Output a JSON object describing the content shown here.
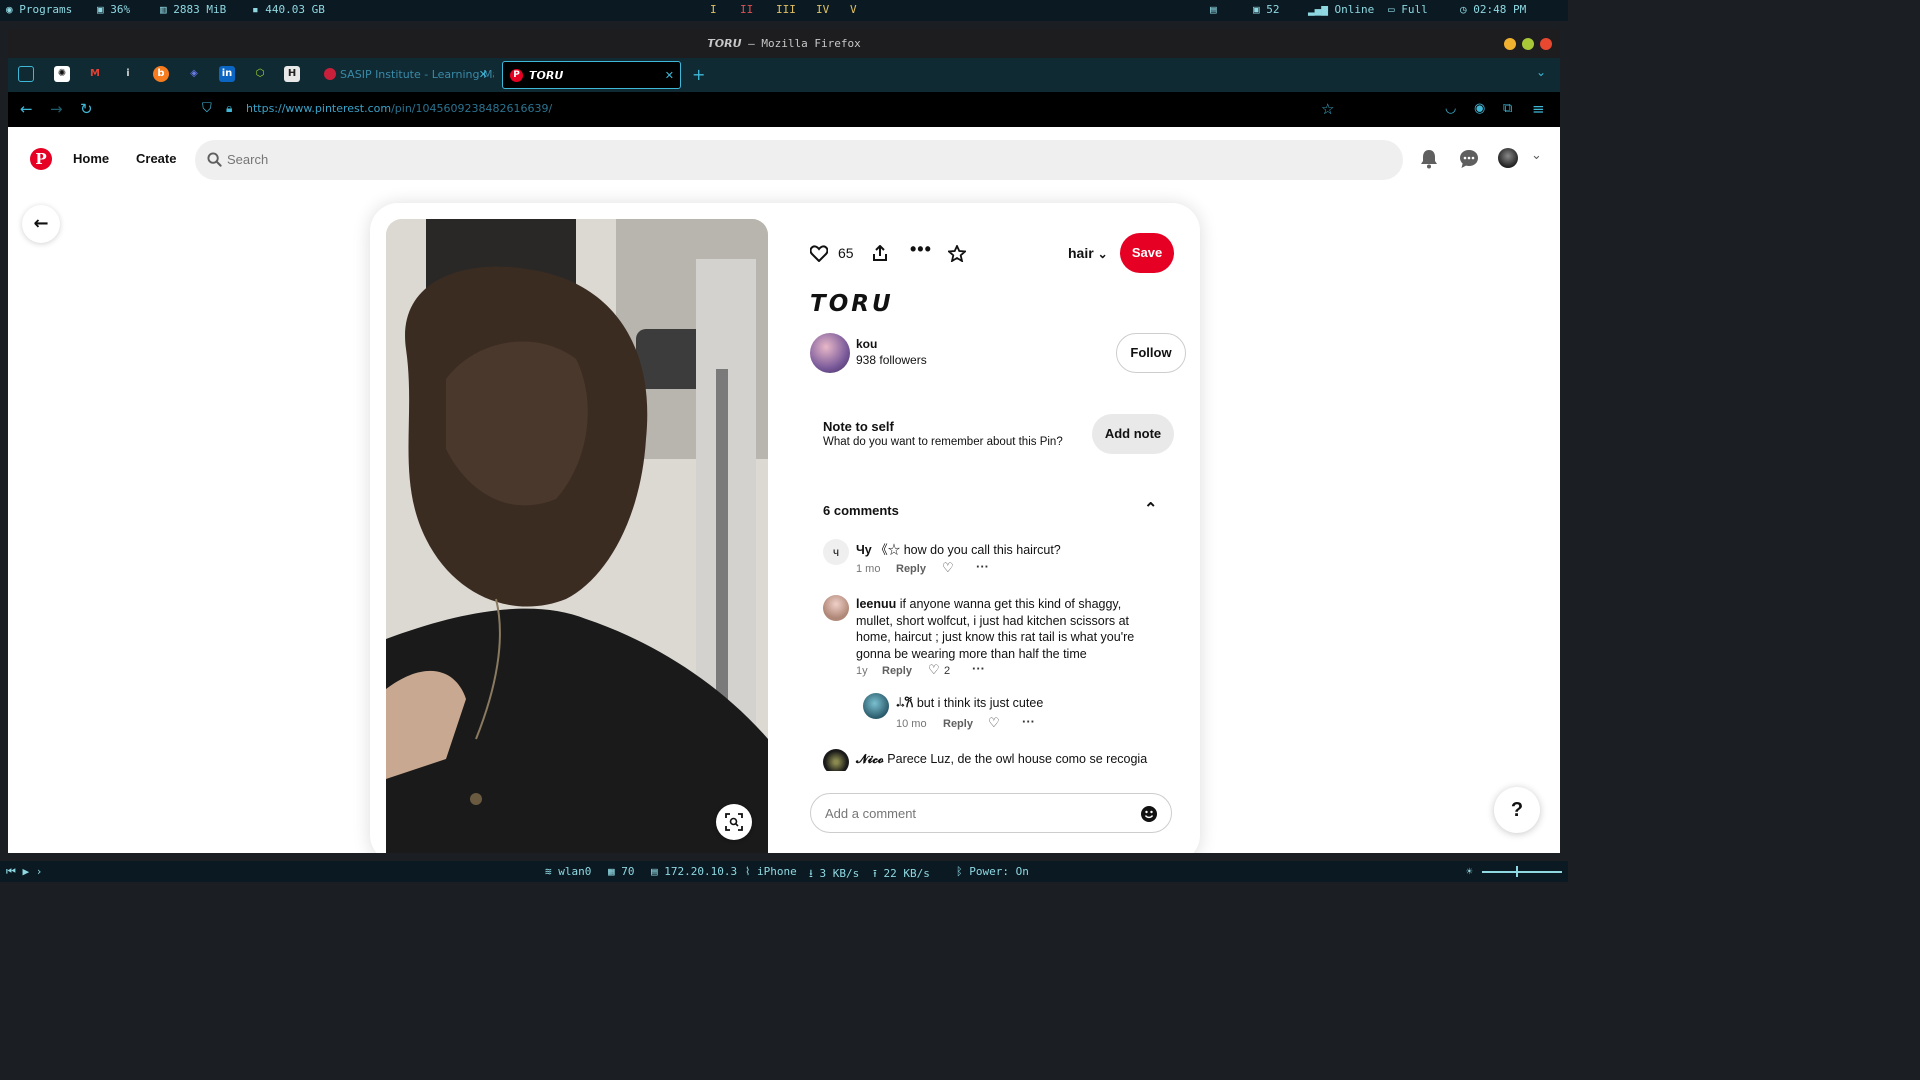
{
  "topbar": {
    "programs": "Programs",
    "cpu": "36%",
    "memory": "2883 MiB",
    "disk": "440.03 GB",
    "workspaces": [
      "I",
      "II",
      "III",
      "IV",
      "V"
    ],
    "active_workspace": "II",
    "updates": "52",
    "network": "Online",
    "battery": "Full",
    "clock": "02:48 PM"
  },
  "window": {
    "title": "𝙏𝙊𝙍𝙐 — Mozilla Firefox"
  },
  "tabs": [
    {
      "label": "SASIP Institute - Learning Ma",
      "active": false
    },
    {
      "label": "𝙏𝙊𝙍𝙐",
      "active": true
    }
  ],
  "address_bar": {
    "url_host": "https://www.pinterest.com",
    "url_path": "/pin/1045609238482616639/"
  },
  "pinterest": {
    "nav": {
      "home": "Home",
      "create": "Create"
    },
    "search_placeholder": "Search",
    "pin": {
      "like_count": "65",
      "board": "hair",
      "save_label": "Save",
      "title": "𝙏𝙊𝙍𝙐",
      "creator_name": "kou",
      "creator_followers": "938 followers",
      "follow_label": "Follow"
    },
    "note": {
      "title": "Note to self",
      "subtitle": "What do you want to remember about this Pin?",
      "button": "Add note"
    },
    "comments_header": "6 comments",
    "reply_label": "Reply",
    "comments": [
      {
        "initial": "ч",
        "author": "Чу",
        "text": "《☆ how do you call this haircut?",
        "age": "1 mo",
        "likes": ""
      },
      {
        "author": "leenuu",
        "text": "if anyone wanna get this kind of shaggy, mullet, short wolfcut, i just had kitchen scissors at home, haircut ; just know this rat tail is what you're gonna be wearing more than half the time",
        "age": "1y",
        "likes": "2"
      },
      {
        "author": "𝆺𝅥𝆹𐙚",
        "text": "but i think its just cutee",
        "age": "10 mo",
        "likes": ""
      },
      {
        "author": "𝓝𝓲𝓬𝓸",
        "text": "Parece Luz, de the owl house como se recogia",
        "age": "",
        "likes": ""
      }
    ],
    "comment_placeholder": "Add a comment",
    "help_label": "?"
  },
  "bottombar": {
    "interface": "wlan0",
    "signal": "70",
    "ip": "172.20.10.3",
    "ssid": "iPhone",
    "down": "3 KB/s",
    "up": "22 KB/s",
    "bluetooth": "Power: On"
  },
  "colors": {
    "pinterest_red": "#e60023",
    "bar_bg": "#0b1a22",
    "bar_text": "#8fd8e2",
    "url_text": "#3aa3c8"
  }
}
